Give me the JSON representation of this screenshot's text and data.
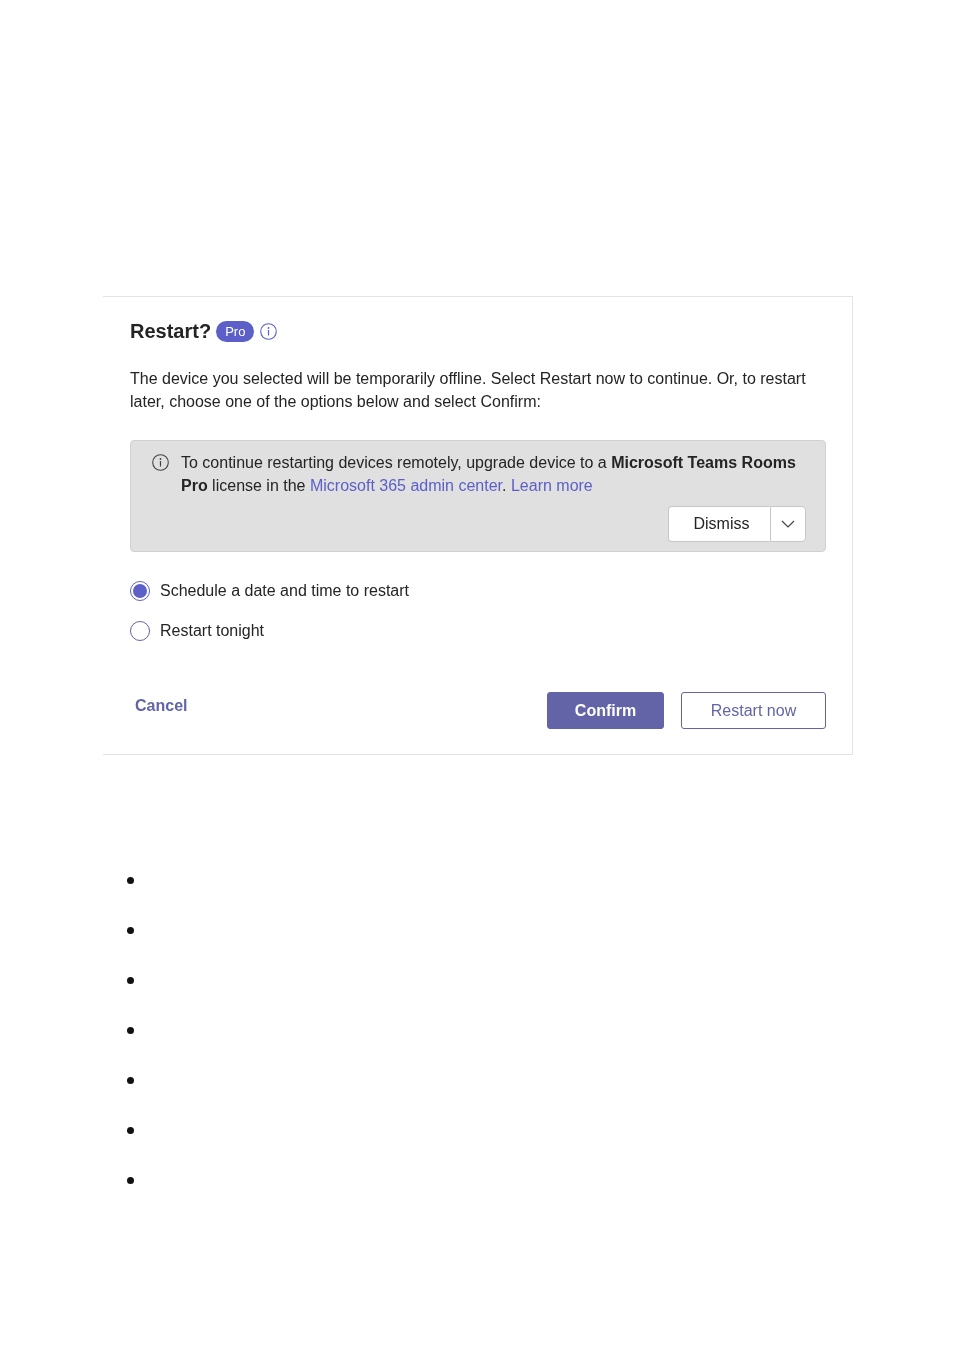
{
  "dialog": {
    "title": "Restart?",
    "badge": "Pro",
    "description": "The device you selected will be temporarily offline. Select Restart now to continue. Or, to restart later, choose one of the options below and select Confirm:",
    "message_bar": {
      "segments": [
        {
          "kind": "text",
          "text": "To continue restarting devices remotely, upgrade device to a **Microsoft Teams Rooms Pro** license in the "
        },
        {
          "kind": "link",
          "text": "Microsoft 365 admin center"
        },
        {
          "kind": "text",
          "text": ". "
        },
        {
          "kind": "link",
          "text": "Learn more"
        }
      ],
      "dismiss": "Dismiss"
    },
    "options": [
      {
        "label": "Schedule a date and time to restart",
        "selected": true
      },
      {
        "label": "Restart tonight",
        "selected": false
      }
    ],
    "cancel": "Cancel",
    "buttons": [
      {
        "label": "Confirm",
        "kind": "primary"
      },
      {
        "label": "Restart now",
        "kind": "secondary"
      }
    ]
  },
  "bullet_list": [
    {
      "kind": "bullet"
    },
    {
      "kind": "bullet"
    },
    {
      "kind": "bullet"
    },
    {
      "kind": "bullet"
    },
    {
      "kind": "bullet"
    },
    {
      "kind": "bullet"
    },
    {
      "kind": "bullet"
    }
  ]
}
